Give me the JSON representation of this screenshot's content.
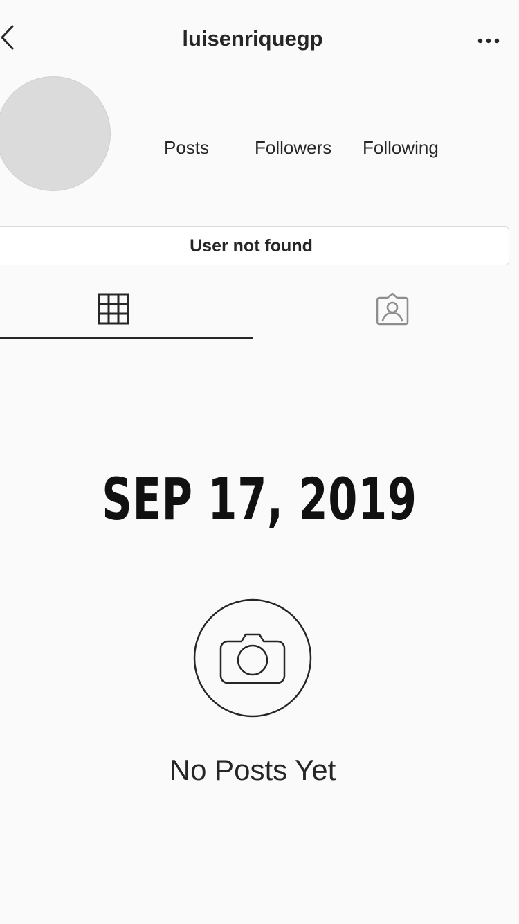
{
  "header": {
    "username": "luisenrique​gp",
    "back_icon": "chevron-left-icon",
    "more_icon": "ellipsis-icon"
  },
  "profile": {
    "stats": {
      "posts_label": "Posts",
      "followers_label": "Followers",
      "following_label": "Following"
    },
    "status_message": "User not found"
  },
  "tabs": [
    {
      "icon": "grid-icon",
      "selected": true
    },
    {
      "icon": "tagged-person-icon",
      "selected": false
    }
  ],
  "overlay": {
    "date": "SEP 17, 2019"
  },
  "empty_state": {
    "icon": "camera-icon",
    "message": "No Posts Yet"
  },
  "colors": {
    "background": "#fafafa",
    "text": "#262626",
    "border": "#dbdbdb",
    "avatar": "#dbdbdb",
    "muted_icon": "#8e8e8e"
  }
}
